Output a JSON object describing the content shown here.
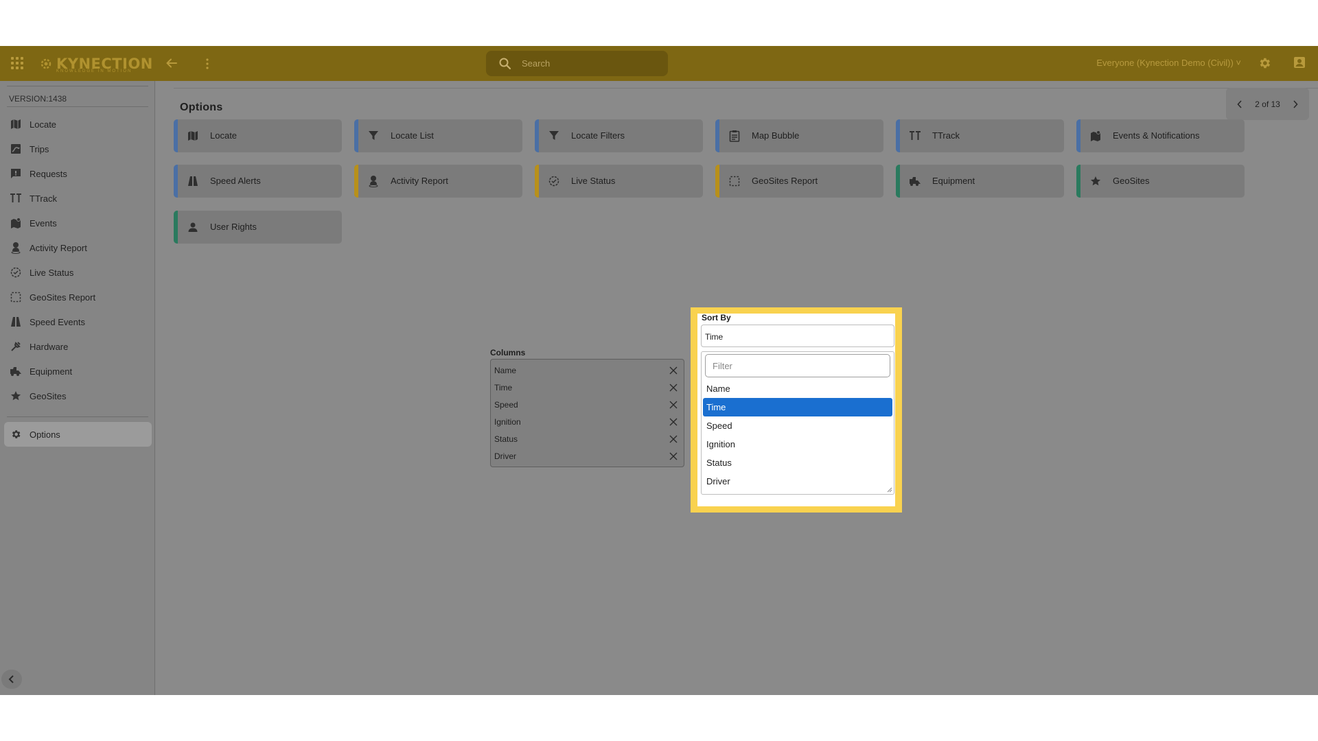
{
  "header": {
    "logo_text": "KYNECTION",
    "logo_sub": "KNOWLEDGE IN MOTION",
    "search_placeholder": "Search",
    "scope_label": "Everyone (Kynection Demo (Civil)) ˅"
  },
  "sidebar": {
    "version": "VERSION:1438",
    "items": [
      {
        "label": "Locate",
        "icon": "map-icon"
      },
      {
        "label": "Trips",
        "icon": "trips-icon"
      },
      {
        "label": "Requests",
        "icon": "requests-icon"
      },
      {
        "label": "TTrack",
        "icon": "ttrack-icon"
      },
      {
        "label": "Events",
        "icon": "events-icon"
      },
      {
        "label": "Activity Report",
        "icon": "person-pin-icon"
      },
      {
        "label": "Live Status",
        "icon": "live-status-icon"
      },
      {
        "label": "GeoSites Report",
        "icon": "dashed-square-icon"
      },
      {
        "label": "Speed Events",
        "icon": "road-icon"
      },
      {
        "label": "Hardware",
        "icon": "hardware-icon"
      },
      {
        "label": "Equipment",
        "icon": "equipment-icon"
      },
      {
        "label": "GeoSites",
        "icon": "star-icon"
      }
    ],
    "active_item": {
      "label": "Options",
      "icon": "gear-icon"
    }
  },
  "main": {
    "title": "Options",
    "pager": "2 of 13",
    "tiles": [
      {
        "label": "Locate",
        "color": "#4a6fa5"
      },
      {
        "label": "Locate List",
        "color": "#4a6fa5"
      },
      {
        "label": "Locate Filters",
        "color": "#4a6fa5"
      },
      {
        "label": "Map Bubble",
        "color": "#4a6fa5"
      },
      {
        "label": "TTrack",
        "color": "#4a6fa5"
      },
      {
        "label": "Events & Notifications",
        "color": "#4a6fa5"
      },
      {
        "label": "Speed Alerts",
        "color": "#4a6fa5"
      },
      {
        "label": "Activity Report",
        "color": "#b8901a"
      },
      {
        "label": "Live Status",
        "color": "#b8901a"
      },
      {
        "label": "GeoSites Report",
        "color": "#b8901a"
      },
      {
        "label": "Equipment",
        "color": "#2a7a5e"
      },
      {
        "label": "GeoSites",
        "color": "#2a7a5e"
      },
      {
        "label": "User Rights",
        "color": "#2a7a5e"
      }
    ],
    "columns_label": "Columns",
    "columns": [
      "Name",
      "Time",
      "Speed",
      "Ignition",
      "Status",
      "Driver"
    ],
    "sort": {
      "label": "Sort By",
      "value": "Time",
      "filter_placeholder": "Filter",
      "options": [
        "Name",
        "Time",
        "Speed",
        "Ignition",
        "Status",
        "Driver"
      ],
      "selected": "Time"
    }
  },
  "colors": {
    "topbar": "#7e6713",
    "highlight": "#f9d24f",
    "selected_option": "#1a6fd0"
  }
}
